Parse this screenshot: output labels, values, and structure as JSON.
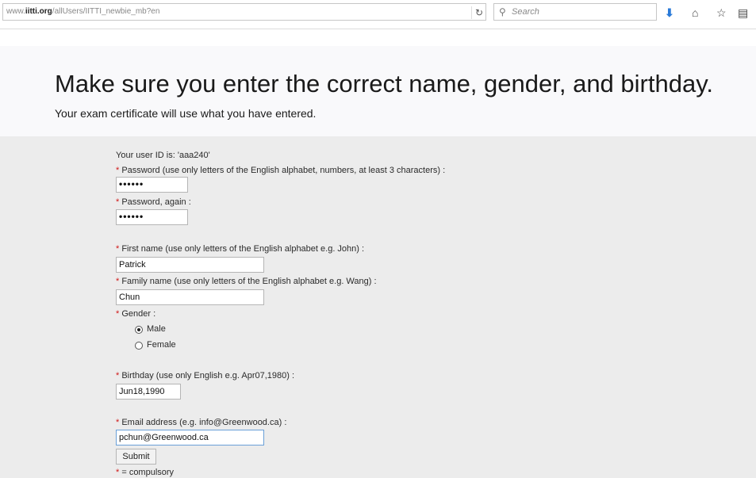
{
  "browser": {
    "url_prefix": "www.",
    "url_domain": "iitti.org",
    "url_path": "/allUsers/IITTI_newbie_mb?en",
    "search_placeholder": "Search"
  },
  "header": {
    "title": "Make sure you enter the correct name, gender, and birthday.",
    "subtitle": "Your exam certificate will use what you have entered."
  },
  "form": {
    "user_id_text": "Your user ID is: 'aaa240'",
    "required_mark": "*",
    "password_label": " Password (use only letters of the English alphabet, numbers, at least 3 characters) :",
    "password_value": "••••••",
    "password_again_label": " Password, again :",
    "password_again_value": "••••••",
    "first_name_label": " First name (use only letters of the English alphabet e.g. John) :",
    "first_name_value": "Patrick",
    "family_name_label": " Family name (use only letters of the English alphabet e.g. Wang) :",
    "family_name_value": "Chun",
    "gender_label": " Gender :",
    "gender_options": [
      "Male",
      "Female"
    ],
    "gender_selected": "Male",
    "birthday_label": " Birthday (use only English e.g. Apr07,1980) :",
    "birthday_value": "Jun18,1990",
    "email_label": " Email address (e.g. info@Greenwood.ca) :",
    "email_value": "pchun@Greenwood.ca",
    "submit_label": "Submit",
    "compulsory_note": " = compulsory"
  },
  "colors": {
    "required_star": "#d01818",
    "download_icon": "#2a7ad8"
  }
}
